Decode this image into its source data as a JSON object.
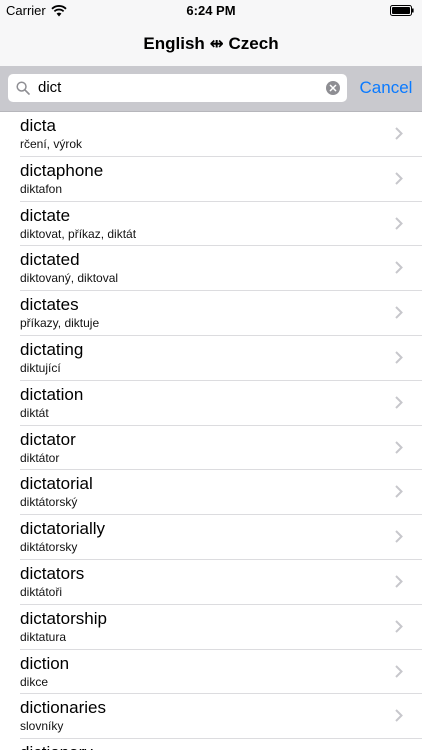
{
  "status_bar": {
    "carrier": "Carrier",
    "time": "6:24 PM",
    "wifi_icon": "wifi-icon",
    "battery_icon": "battery-icon"
  },
  "nav": {
    "title": "English ⇹ Czech"
  },
  "search": {
    "value": "dict",
    "cancel_label": "Cancel",
    "search_icon": "search-icon",
    "clear_icon": "clear-icon"
  },
  "colors": {
    "accent": "#0a7aff",
    "search_bar_bg": "#c9c9ce",
    "nav_bg": "#f7f7f8",
    "separator": "#dcdcdf",
    "chevron": "#c7c7cc"
  },
  "results": [
    {
      "word": "dicta",
      "translation": "rčení, výrok"
    },
    {
      "word": "dictaphone",
      "translation": "diktafon"
    },
    {
      "word": "dictate",
      "translation": "diktovat, příkaz, diktát"
    },
    {
      "word": "dictated",
      "translation": "diktovaný, diktoval"
    },
    {
      "word": "dictates",
      "translation": "příkazy, diktuje"
    },
    {
      "word": "dictating",
      "translation": "diktující"
    },
    {
      "word": "dictation",
      "translation": "diktát"
    },
    {
      "word": "dictator",
      "translation": "diktátor"
    },
    {
      "word": "dictatorial",
      "translation": "diktátorský"
    },
    {
      "word": "dictatorially",
      "translation": "diktátorsky"
    },
    {
      "word": "dictators",
      "translation": "diktátoři"
    },
    {
      "word": "dictatorship",
      "translation": "diktatura"
    },
    {
      "word": "diction",
      "translation": "dikce"
    },
    {
      "word": "dictionaries",
      "translation": "slovníky"
    },
    {
      "word": "dictionary",
      "translation": ""
    }
  ]
}
